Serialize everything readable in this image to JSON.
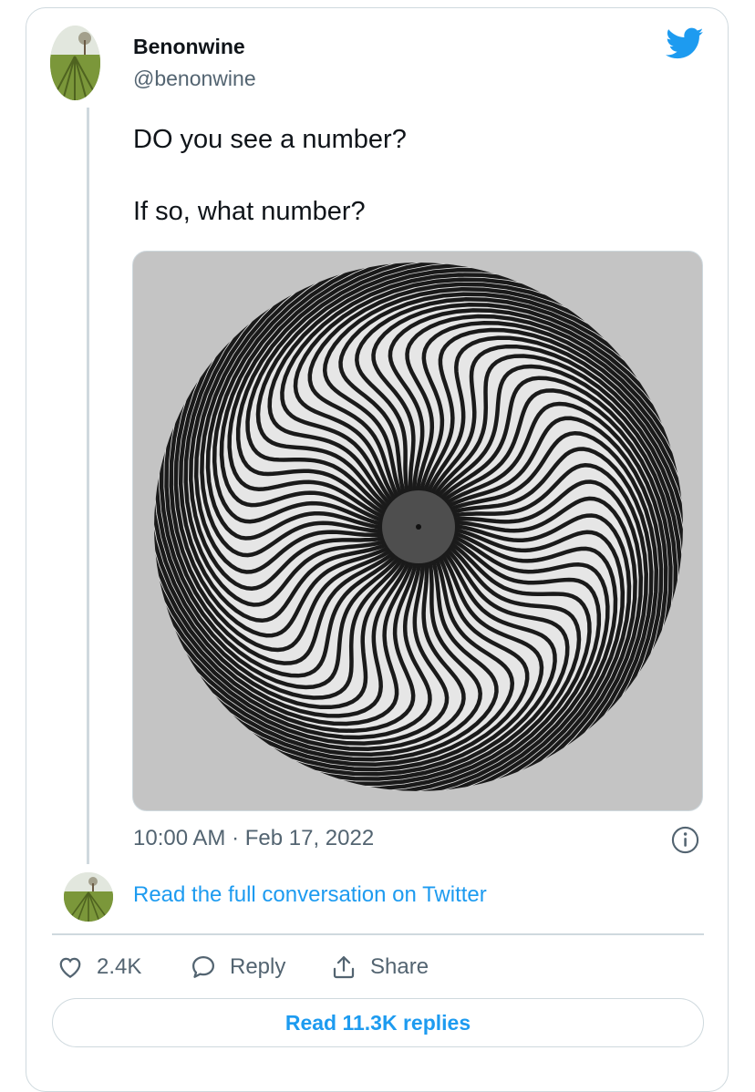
{
  "tweet": {
    "author_name": "Benonwine",
    "author_handle": "@benonwine",
    "text_line1": "DO you see a number?",
    "text_line2": "If so, what number?",
    "timestamp": "10:00 AM · Feb 17, 2022",
    "read_conversation": "Read the full conversation on Twitter"
  },
  "actions": {
    "likes_count": "2.4K",
    "reply_label": "Reply",
    "share_label": "Share",
    "read_replies": "Read 11.3K replies"
  },
  "icons": {
    "brand": "twitter-bird-icon",
    "info": "info-icon",
    "like": "heart-icon",
    "reply": "speech-bubble-icon",
    "share": "share-upload-icon"
  },
  "colors": {
    "accent": "#1d9bf0",
    "secondary_text": "#536471",
    "border": "#cfd9de",
    "media_background": "#c4c4c4"
  }
}
